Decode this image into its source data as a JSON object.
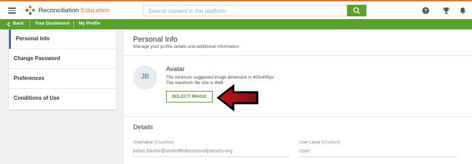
{
  "header": {
    "brand_part1": "Reconciliation",
    "brand_part2": "Education",
    "search_placeholder": "Search content in the platform",
    "colors": {
      "accent": "#5aa02c",
      "brand_orange": "#e8742a"
    }
  },
  "breadcrumb": {
    "back": "Back",
    "dashboard": "Your Dashboard",
    "profile": "My Profile"
  },
  "sidebar": {
    "items": [
      {
        "label": "Personal Info",
        "active": true
      },
      {
        "label": "Change Password"
      },
      {
        "label": "Preferences"
      },
      {
        "label": "Conditions of Use"
      }
    ]
  },
  "personal_info": {
    "title": "Personal Info",
    "subtitle": "Manage your profile details and additional information"
  },
  "avatar": {
    "initials": "JB",
    "title": "Avatar",
    "line1": "The minimum suggested image dimension is 400x400px",
    "line2": "The maximum file size is 4MB",
    "button": "SELECT IMAGE"
  },
  "details": {
    "title": "Details",
    "username_label": "Username",
    "username_status": "(Disabled)",
    "username_value": "julian.bashir@unitedfederationofplanets.org",
    "user_level_label": "User Level",
    "user_level_status": "(Disabled)",
    "user_level_value": "User"
  }
}
